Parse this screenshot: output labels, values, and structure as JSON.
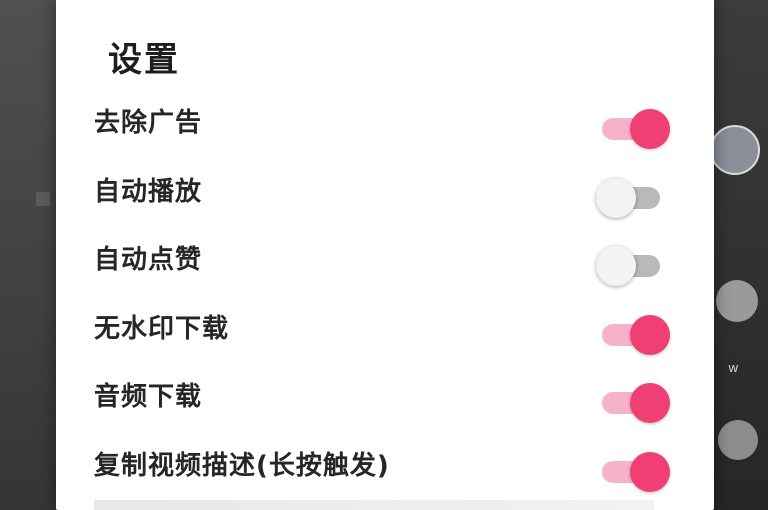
{
  "dialog": {
    "title": "设置"
  },
  "settings": [
    {
      "label": "去除广告",
      "enabled": true
    },
    {
      "label": "自动播放",
      "enabled": false
    },
    {
      "label": "自动点赞",
      "enabled": false
    },
    {
      "label": "无水印下载",
      "enabled": true
    },
    {
      "label": "音频下载",
      "enabled": true
    },
    {
      "label": "复制视频描述(长按触发)",
      "enabled": true
    }
  ],
  "background": {
    "side_label": "w"
  },
  "colors": {
    "toggle_on_thumb": "#ef3f74",
    "toggle_on_track": "#f6b2c8",
    "toggle_off_thumb": "#f3f3f3",
    "toggle_off_track": "#b9b9b9"
  }
}
